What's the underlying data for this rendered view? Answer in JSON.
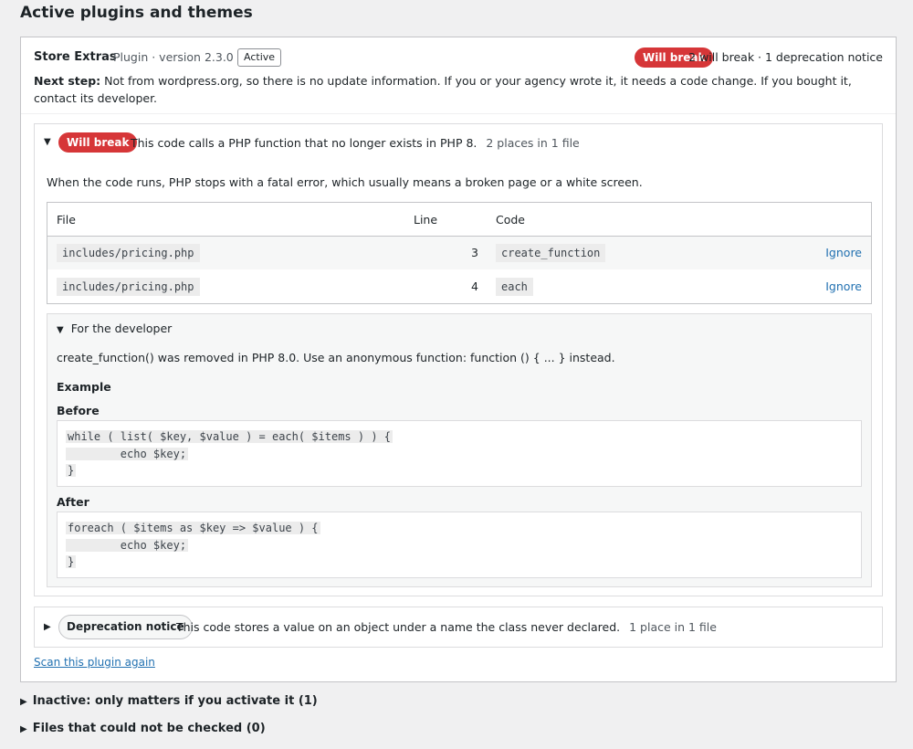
{
  "page": {
    "title": "Active plugins and themes"
  },
  "plugin": {
    "name": "Store Extras",
    "meta": "Plugin · version 2.3.0",
    "status_badge": "Active",
    "severity_pill": "Will break",
    "counts": "2 will break · 1 deprecation notice",
    "next_step_label": "Next step:",
    "next_step_text": "Not from wordpress.org, so there is no update information. If you or your agency wrote it, it needs a code change. If you bought it, contact its developer."
  },
  "finding": {
    "pill": "Will break",
    "description": "This code calls a PHP function that no longer exists in PHP 8.",
    "places": "2 places in 1 file",
    "impact": "When the code runs, PHP stops with a fatal error, which usually means a broken page or a white screen.",
    "table": {
      "headers": {
        "file": "File",
        "line": "Line",
        "code": "Code"
      },
      "rows": [
        {
          "file": "includes/pricing.php",
          "line": "3",
          "code": "create_function",
          "action": "Ignore"
        },
        {
          "file": "includes/pricing.php",
          "line": "4",
          "code": "each",
          "action": "Ignore"
        }
      ]
    },
    "developer": {
      "toggle": "For the developer",
      "text": "create_function() was removed in PHP 8.0. Use an anonymous function: function () { ... } instead.",
      "example_label": "Example",
      "before_label": "Before",
      "before_code": [
        "while ( list( $key, $value ) = each( $items ) ) {",
        "        echo $key;",
        "}"
      ],
      "after_label": "After",
      "after_code": [
        "foreach ( $items as $key => $value ) {",
        "        echo $key;",
        "}"
      ]
    }
  },
  "deprecation": {
    "pill": "Deprecation notice",
    "description": "This code stores a value on an object under a name the class never declared.",
    "places": "1 place in 1 file"
  },
  "rescan_link": "Scan this plugin again",
  "sections": {
    "inactive": "Inactive: only matters if you activate it (1)",
    "unchecked": "Files that could not be checked (0)"
  },
  "colors": {
    "danger": "#d63638",
    "link": "#2271b1"
  },
  "icons": {
    "expanded": "triangle-down-icon",
    "collapsed": "triangle-right-icon"
  }
}
